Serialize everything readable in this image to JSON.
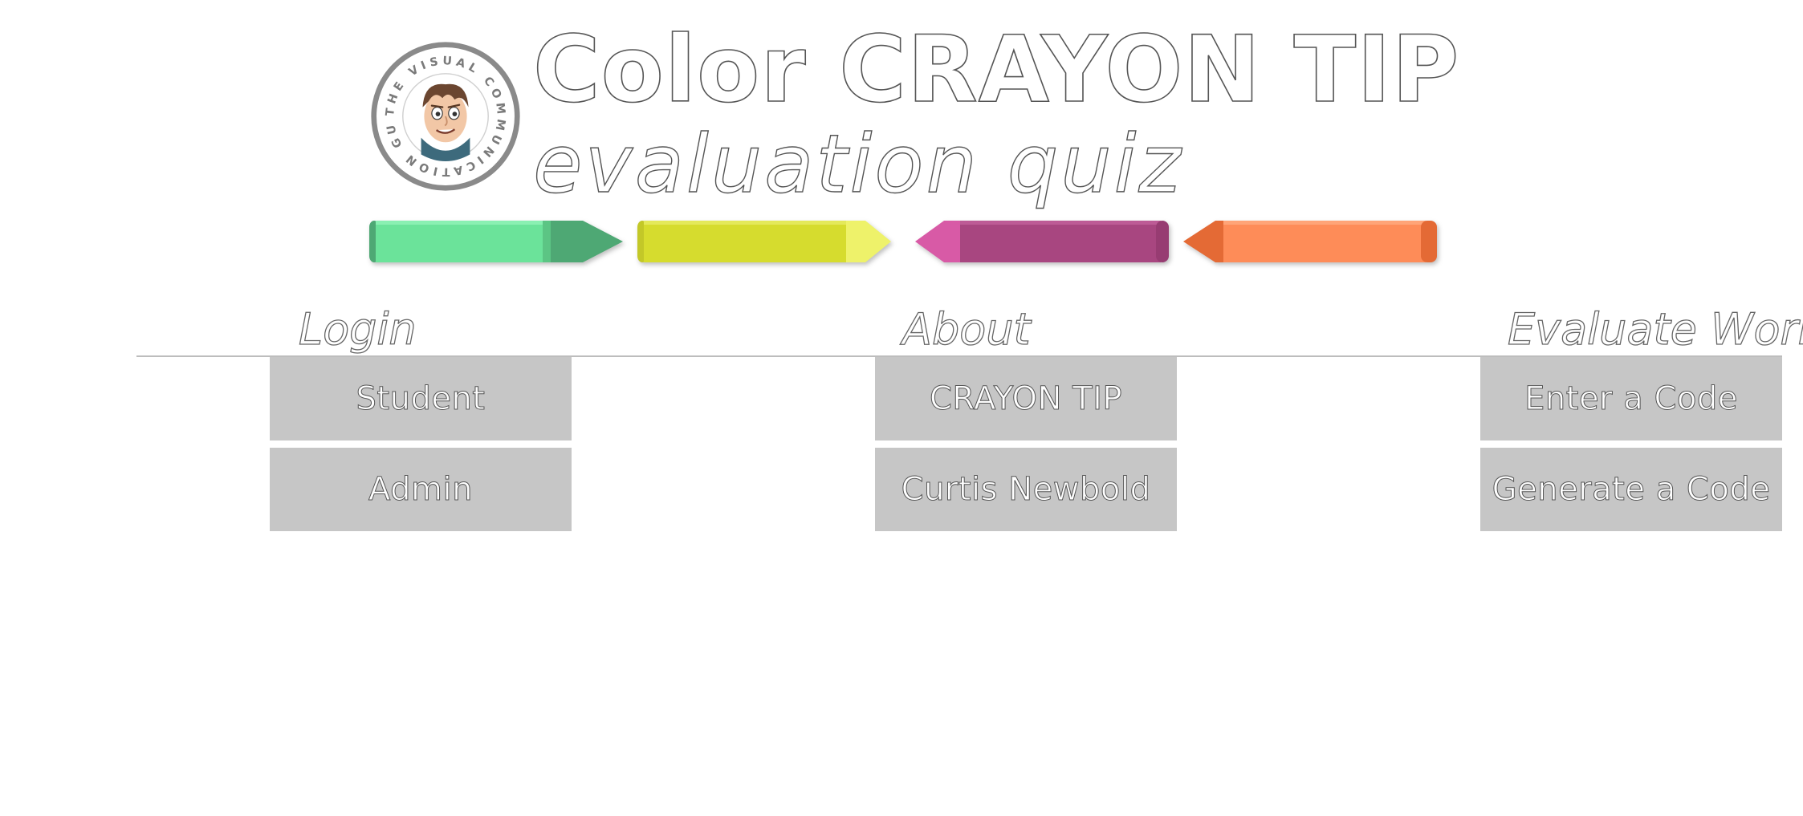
{
  "header": {
    "logo_text": "THE VISUAL COMMUNICATION GUY",
    "title": "Color CRAYON TIP",
    "subtitle": "evaluation quiz"
  },
  "crayons": [
    {
      "name": "green-crayon",
      "body_color": "#6be39a",
      "tip_color": "#4ea874",
      "pointing": "right"
    },
    {
      "name": "yellow-crayon",
      "body_color": "#d6dc2e",
      "tip_color": "#eef26a",
      "pointing": "right"
    },
    {
      "name": "purple-crayon",
      "body_color": "#a84680",
      "tip_color": "#d85aa6",
      "pointing": "left"
    },
    {
      "name": "orange-crayon",
      "body_color": "#fe8c58",
      "tip_color": "#e46a35",
      "pointing": "left"
    }
  ],
  "nav": {
    "login": {
      "heading": "Login",
      "buttons": [
        {
          "label": "Student"
        },
        {
          "label": "Admin"
        }
      ]
    },
    "about": {
      "heading": "About",
      "buttons": [
        {
          "label": "CRAYON TIP"
        },
        {
          "label": "Curtis Newbold"
        }
      ]
    },
    "evaluate": {
      "heading": "Evaluate Work",
      "buttons": [
        {
          "label": "Enter a Code"
        },
        {
          "label": "Generate a Code"
        }
      ]
    }
  },
  "colors": {
    "button_bg": "#c6c6c6",
    "divider": "#bdbdbd",
    "text_outline": "#555555",
    "logo_ring": "#888888",
    "logo_accent": "#f5a04a"
  }
}
